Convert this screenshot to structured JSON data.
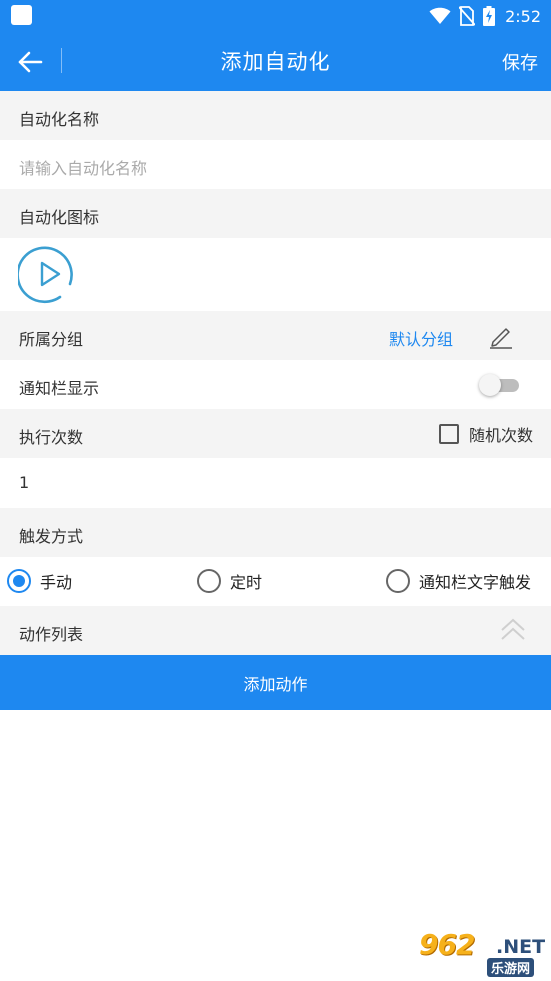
{
  "status_bar": {
    "time": "2:52",
    "icons": [
      "app-icon",
      "wifi-icon",
      "no-sim-icon",
      "battery-charging-icon"
    ]
  },
  "app_bar": {
    "title": "添加自动化",
    "save_label": "保存"
  },
  "form": {
    "name_label": "自动化名称",
    "name_placeholder": "请输入自动化名称",
    "icon_label": "自动化图标",
    "icon": "play-circle-icon",
    "group_label": "所属分组",
    "group_value": "默认分组",
    "notification_label": "通知栏显示",
    "notification_enabled": false,
    "exec_count_label": "执行次数",
    "random_count_label": "随机次数",
    "random_count_checked": false,
    "exec_count_value": "1",
    "trigger_label": "触发方式",
    "trigger_options": [
      "手动",
      "定时",
      "通知栏文字触发"
    ],
    "trigger_selected": "手动",
    "action_list_label": "动作列表",
    "add_action_label": "添加动作"
  },
  "watermark": {
    "top": "962",
    "net": ".NET",
    "bottom": "乐游网"
  },
  "colors": {
    "primary": "#1e88f0",
    "section_bg": "#f4f4f4",
    "icon_teal": "#3b9fd1"
  }
}
